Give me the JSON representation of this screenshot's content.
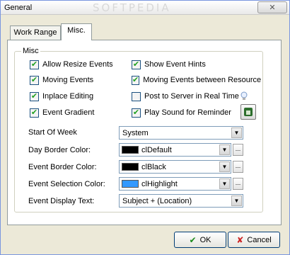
{
  "window": {
    "title": "General",
    "watermark": "SOFTPEDIA",
    "close_glyph": "✕"
  },
  "tabs": [
    {
      "label": "Work Range"
    },
    {
      "label": "Misc."
    }
  ],
  "misc_group": {
    "label": "Misc",
    "checkboxes": [
      {
        "label": "Allow Resize Events",
        "checked": true
      },
      {
        "label": "Show Event Hints",
        "checked": true
      },
      {
        "label": "Moving Events",
        "checked": true
      },
      {
        "label": "Moving Events between Resources",
        "checked": true
      },
      {
        "label": "Inplace Editing",
        "checked": true
      },
      {
        "label": "Post to Server in Real Time",
        "checked": false
      },
      {
        "label": "Event Gradient",
        "checked": true
      },
      {
        "label": "Play Sound for Reminder",
        "checked": true
      }
    ],
    "check_glyph": "✔",
    "fields": {
      "start_of_week": {
        "label": "Start Of Week",
        "value": "System"
      },
      "day_border_color": {
        "label": "Day Border Color:",
        "value": "clDefault",
        "swatch": "#000000"
      },
      "event_border_color": {
        "label": "Event Border Color:",
        "value": "clBlack",
        "swatch": "#000000"
      },
      "event_selection_color": {
        "label": "Event Selection Color:",
        "value": "clHighlight",
        "swatch": "#3399ff"
      },
      "event_display_text": {
        "label": "Event Display Text:",
        "value": "Subject + (Location)"
      }
    },
    "arrow_glyph": "▼",
    "ellipsis_glyph": "..."
  },
  "buttons": {
    "ok": {
      "label": "OK",
      "glyph": "✔",
      "color": "#1a8a1a"
    },
    "cancel": {
      "label": "Cancel",
      "glyph": "✘",
      "color": "#cc2222"
    }
  }
}
